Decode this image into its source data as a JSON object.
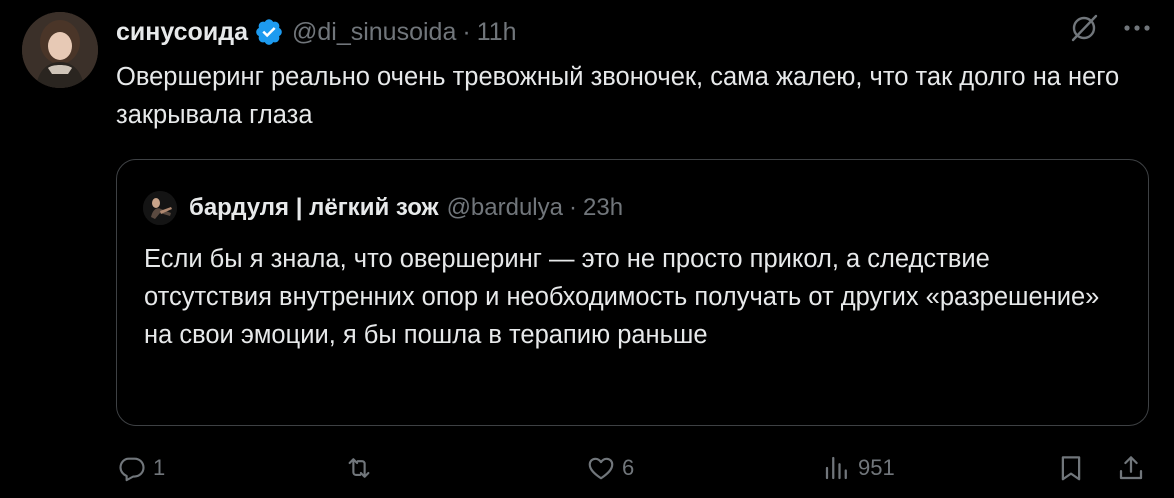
{
  "author": {
    "display_name": "синусоида",
    "handle": "@di_sinusoida",
    "time": "11h",
    "verified": true
  },
  "tweet": {
    "text": "Овершеринг реально очень тревожный звоночек, сама жалею, что так долго на него закрывала глаза"
  },
  "quoted": {
    "display_name": "бардуля | лёгкий зож",
    "handle": "@bardulya",
    "time": "23h",
    "text": "Если бы я знала, что овершеринг — это не просто прикол, а следствие отсутствия внутренних опор и необходимость получать от других «разрешение» на свои эмоции, я бы пошла в терапию раньше"
  },
  "separator": "·",
  "actions": {
    "replies": "1",
    "reposts": "",
    "likes": "6",
    "views": "951"
  },
  "icons": {
    "verified": "verified-badge-icon",
    "grok": "grok-icon",
    "more": "more-dots-icon",
    "reply": "reply-icon",
    "repost": "repost-icon",
    "like": "heart-icon",
    "views": "views-chart-icon",
    "bookmark": "bookmark-icon",
    "share": "share-icon"
  },
  "colors": {
    "background": "#000000",
    "text": "#e7e9ea",
    "secondary": "#71767b",
    "verified": "#1d9bf0",
    "border": "#3e4144"
  }
}
